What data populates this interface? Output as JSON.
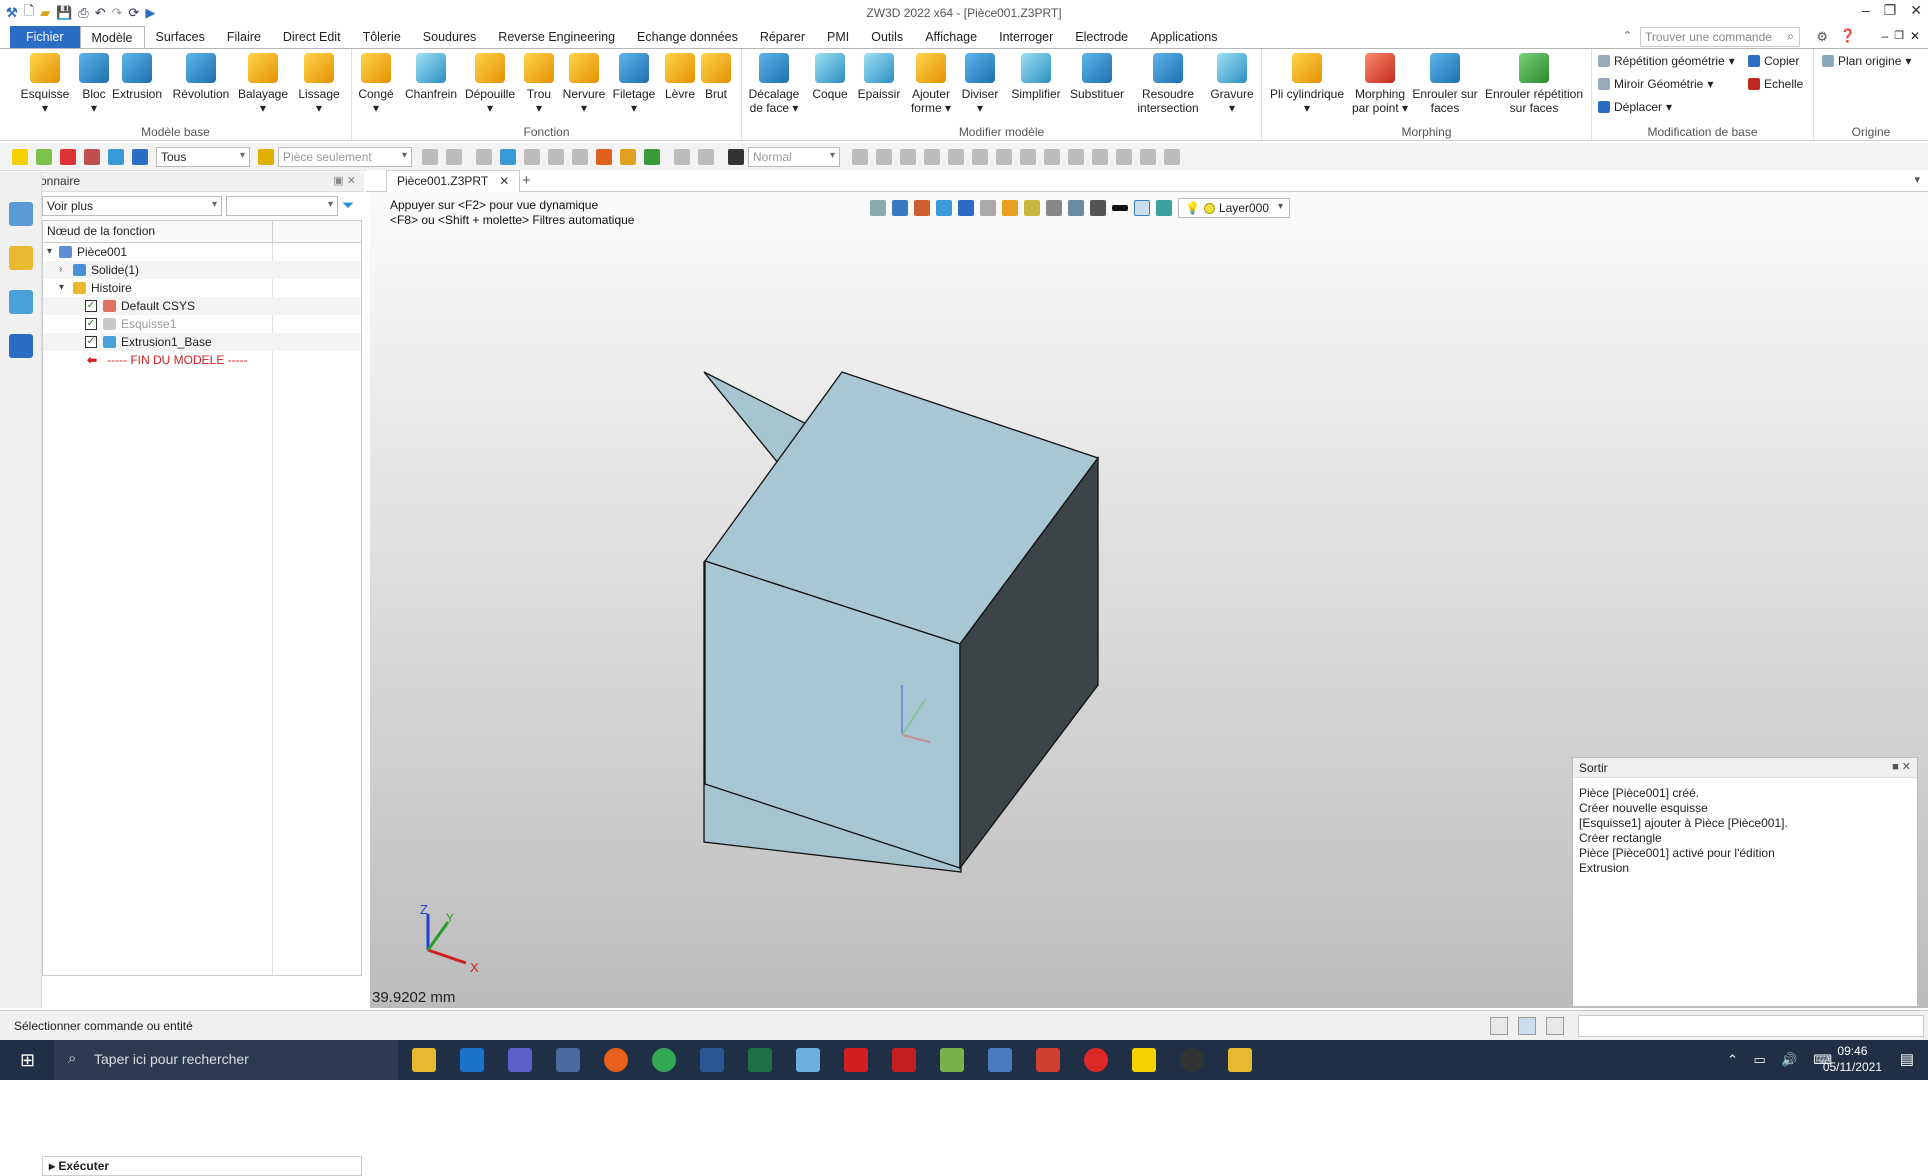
{
  "window": {
    "title": "ZW3D 2022 x64 - [Pièce001.Z3PRT]"
  },
  "menu": {
    "file": "Fichier",
    "tabs": [
      "Modèle",
      "Surfaces",
      "Filaire",
      "Direct Edit",
      "Tôlerie",
      "Soudures",
      "Reverse Engineering",
      "Echange données",
      "Réparer",
      "PMI",
      "Outils",
      "Affichage",
      "Interroger",
      "Electrode",
      "Applications"
    ],
    "search_placeholder": "Trouver une commande"
  },
  "ribbon": {
    "groups": {
      "base": "Modèle base",
      "fonction": "Fonction",
      "modifier": "Modifier modèle",
      "morphing": "Morphing",
      "modif_base": "Modification de base",
      "origine": "Origine"
    },
    "buttons": {
      "esquisse": "Esquisse",
      "bloc": "Bloc",
      "extrusion": "Extrusion",
      "revolution": "Révolution",
      "balayage": "Balayage",
      "lissage": "Lissage",
      "conge": "Congé",
      "chanfrein": "Chanfrein",
      "depouille": "Dépouille",
      "trou": "Trou",
      "nervure": "Nervure",
      "filetage": "Filetage",
      "levre": "Lèvre",
      "brut": "Brut",
      "decalage_1": "Décalage",
      "decalage_2": "de face",
      "coque": "Coque",
      "epaissir": "Epaissir",
      "ajouter_1": "Ajouter",
      "ajouter_2": "forme",
      "diviser": "Diviser",
      "simplifier": "Simplifier",
      "substituer": "Substituer",
      "resoudre_1": "Resoudre",
      "resoudre_2": "intersection",
      "gravure": "Gravure",
      "pli": "Pli cylindrique",
      "morph_1": "Morphing",
      "morph_2": "par point",
      "enrouler_1": "Enrouler sur",
      "enrouler_2": "faces",
      "enrrep_1": "Enrouler répétition",
      "enrrep_2": "sur faces",
      "repetition": "Répétition géométrie",
      "miroir": "Miroir Géométrie",
      "deplacer": "Déplacer",
      "copier": "Copier",
      "echelle": "Echelle",
      "plan": "Plan origine"
    }
  },
  "toolbar2": {
    "filter": "Tous",
    "scope": "Pièce seulement",
    "mode": "Normal"
  },
  "manager": {
    "title": "Gestionnaire",
    "filter": "Voir plus",
    "column": "Nœud de la fonction",
    "tree": [
      {
        "label": "Pièce001"
      },
      {
        "label": "Solide(1)"
      },
      {
        "label": "Histoire"
      },
      {
        "label": "Default CSYS"
      },
      {
        "label": "Esquisse1"
      },
      {
        "label": "Extrusion1_Base"
      },
      {
        "label": "----- FIN DU MODELE -----"
      }
    ],
    "execute": "Exécuter"
  },
  "document": {
    "tab": "Pièce001.Z3PRT",
    "hint1": "Appuyer sur <F2> pour vue dynamique",
    "hint2": "<F8> ou <Shift + molette> Filtres automatique",
    "layer": "Layer000",
    "distance": "39.9202 mm"
  },
  "output": {
    "title": "Sortir",
    "lines": [
      "Pièce [Pièce001] créé.",
      "Créer nouvelle esquisse",
      "[Esquisse1] ajouter à Pièce [Pièce001].",
      "Créer rectangle",
      "Pièce [Pièce001] activé pour l'édition",
      "Extrusion"
    ]
  },
  "status": {
    "text": "Sélectionner commande ou entité"
  },
  "taskbar": {
    "search": "Taper ici pour rechercher",
    "time": "09:46",
    "date": "05/11/2021"
  },
  "axes": {
    "x": "X",
    "y": "Y",
    "z": "Z"
  },
  "colors": {
    "accent": "#2b6cc4",
    "cube_front": "#a7c4d1",
    "cube_side": "#3c4447",
    "error": "#d21f1f"
  }
}
